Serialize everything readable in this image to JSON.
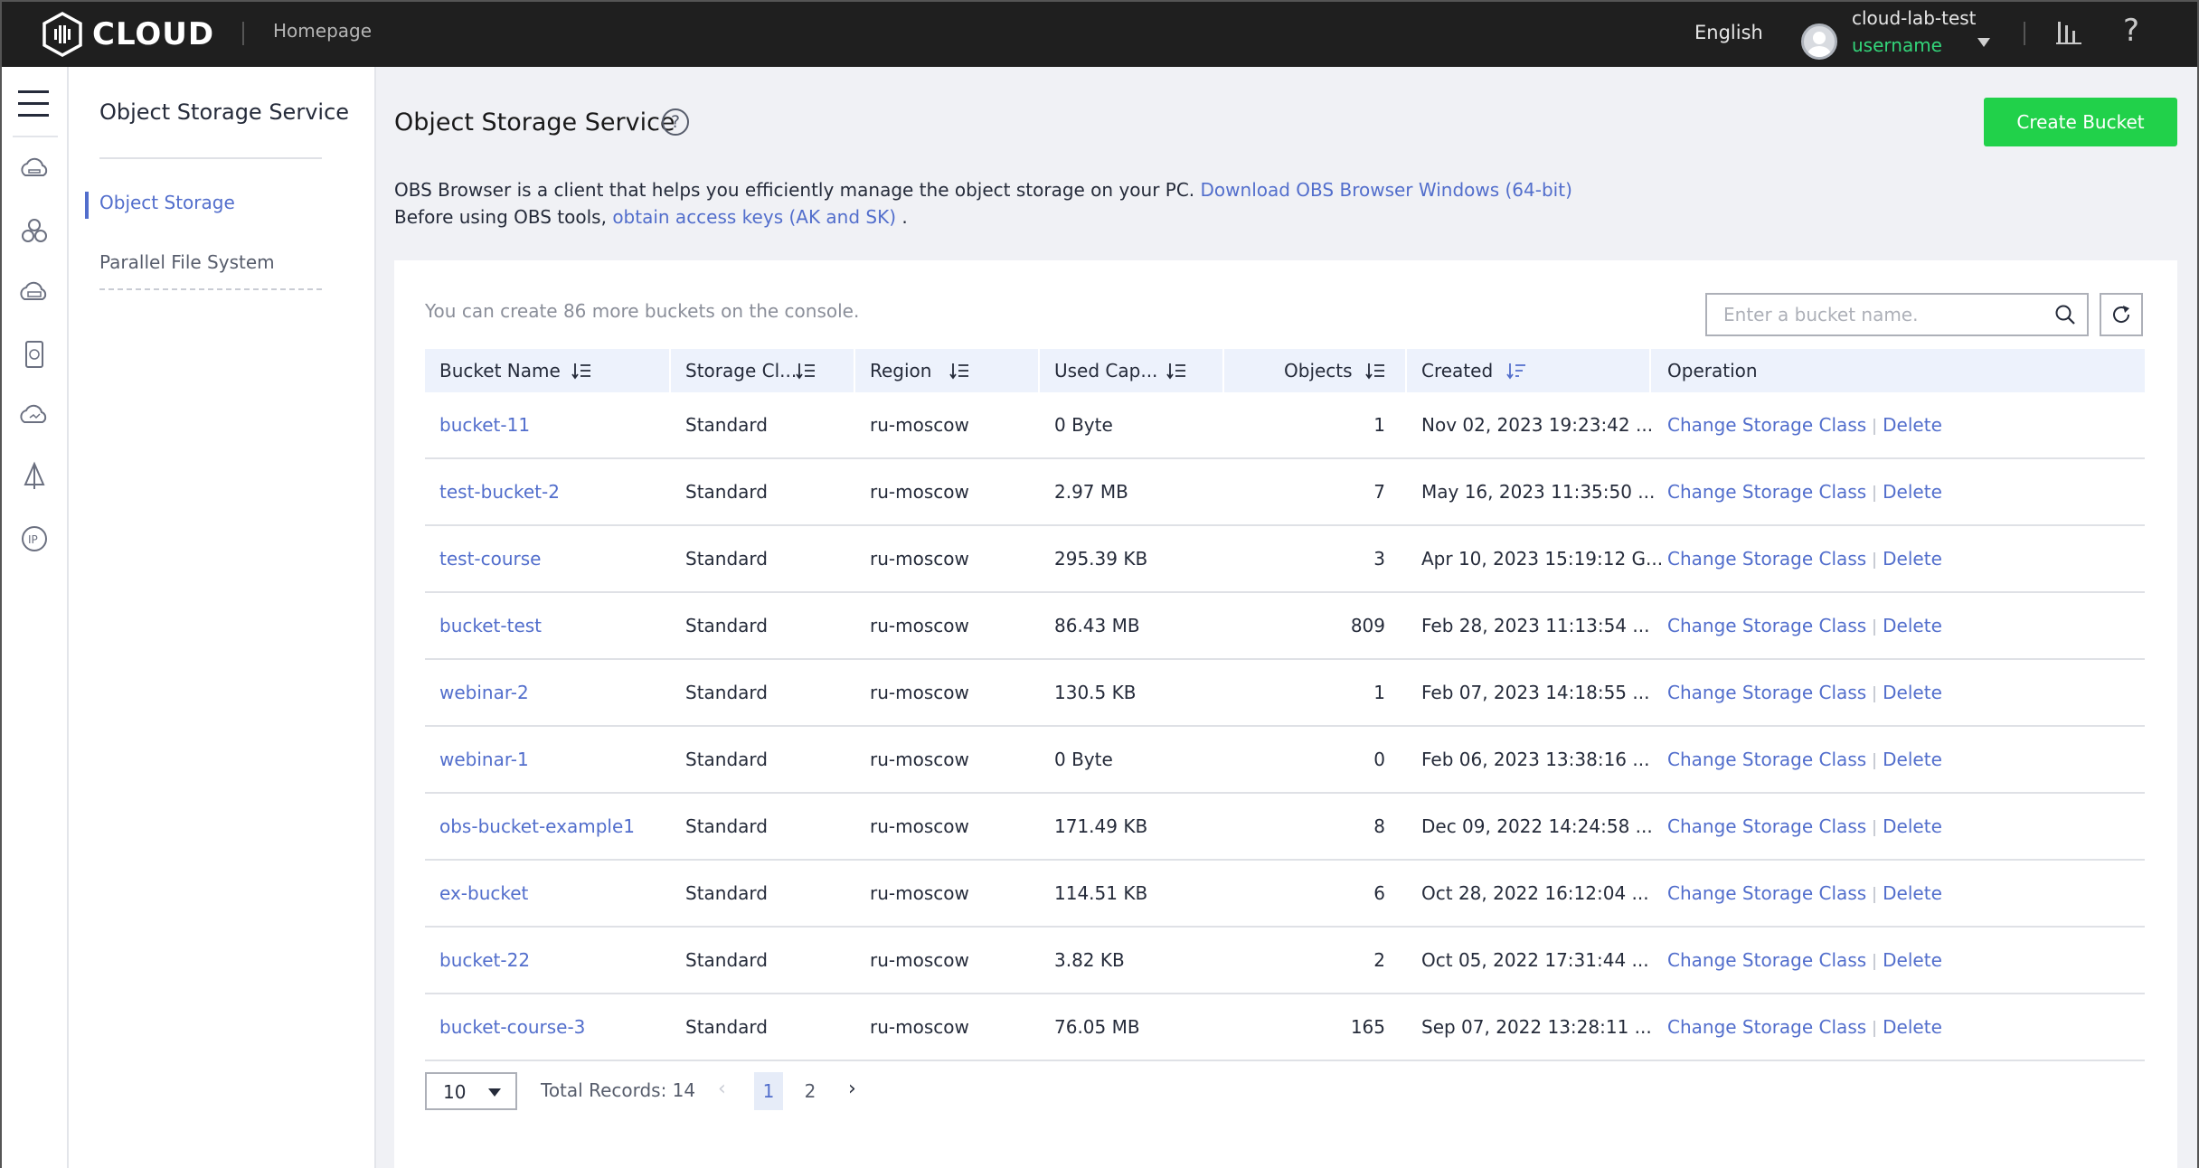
{
  "topbar": {
    "logo_text": "CLOUD",
    "homepage": "Homepage",
    "language": "English",
    "account_name": "cloud-lab-test",
    "username": "username",
    "help": "?"
  },
  "subnav": {
    "title": "Object Storage Service",
    "items": [
      {
        "label": "Object Storage"
      },
      {
        "label": "Parallel File System"
      }
    ]
  },
  "page": {
    "title": "Object Storage Service",
    "help": "?",
    "create_button": "Create Bucket",
    "info1_text": "OBS Browser is a client that helps you efficiently manage the object storage on your PC.",
    "info1_link": "Download OBS Browser Windows (64-bit)",
    "info2_text": "Before using OBS tools,",
    "info2_link": "obtain access keys (AK and SK)",
    "info2_end": ".",
    "quota": "You can create 86 more buckets on the console.",
    "search_placeholder": "Enter a bucket name."
  },
  "table": {
    "columns": [
      "Bucket Name",
      "Storage Cl...",
      "Region",
      "Used Cap...",
      "Objects",
      "Created",
      "Operation"
    ],
    "rows": [
      {
        "name": "bucket-11",
        "storage": "Standard",
        "region": "ru-moscow",
        "used": "0 Byte",
        "objects": "1",
        "created": "Nov 02, 2023 19:23:42 ..."
      },
      {
        "name": "test-bucket-2",
        "storage": "Standard",
        "region": "ru-moscow",
        "used": "2.97 MB",
        "objects": "7",
        "created": "May 16, 2023 11:35:50 ..."
      },
      {
        "name": "test-course",
        "storage": "Standard",
        "region": "ru-moscow",
        "used": "295.39 KB",
        "objects": "3",
        "created": "Apr 10, 2023 15:19:12 G..."
      },
      {
        "name": "bucket-test",
        "storage": "Standard",
        "region": "ru-moscow",
        "used": "86.43 MB",
        "objects": "809",
        "created": "Feb 28, 2023 11:13:54 ..."
      },
      {
        "name": "webinar-2",
        "storage": "Standard",
        "region": "ru-moscow",
        "used": "130.5 KB",
        "objects": "1",
        "created": "Feb 07, 2023 14:18:55 ..."
      },
      {
        "name": "webinar-1",
        "storage": "Standard",
        "region": "ru-moscow",
        "used": "0 Byte",
        "objects": "0",
        "created": "Feb 06, 2023 13:38:16 ..."
      },
      {
        "name": "obs-bucket-example1",
        "storage": "Standard",
        "region": "ru-moscow",
        "used": "171.49 KB",
        "objects": "8",
        "created": "Dec 09, 2022 14:24:58 ..."
      },
      {
        "name": "ex-bucket",
        "storage": "Standard",
        "region": "ru-moscow",
        "used": "114.51 KB",
        "objects": "6",
        "created": "Oct 28, 2022 16:12:04 ..."
      },
      {
        "name": "bucket-22",
        "storage": "Standard",
        "region": "ru-moscow",
        "used": "3.82 KB",
        "objects": "2",
        "created": "Oct 05, 2022 17:31:44 ..."
      },
      {
        "name": "bucket-course-3",
        "storage": "Standard",
        "region": "ru-moscow",
        "used": "76.05 MB",
        "objects": "165",
        "created": "Sep 07, 2022 13:28:11 ..."
      }
    ],
    "op_change": "Change Storage Class",
    "op_delete": "Delete"
  },
  "pagination": {
    "page_size": "10",
    "total": "Total Records: 14",
    "pages": [
      "1",
      "2"
    ],
    "current": "1"
  },
  "colors": {
    "accent": "#526ecc",
    "create_button": "#21d14a",
    "username": "#33d67a",
    "topbar": "#1f1f1f"
  },
  "rail_icons": [
    "cloud-server-icon",
    "cluster-icon",
    "storage-cloud-icon",
    "disk-icon",
    "cloud-monitor-icon",
    "network-icon",
    "eip-icon"
  ]
}
